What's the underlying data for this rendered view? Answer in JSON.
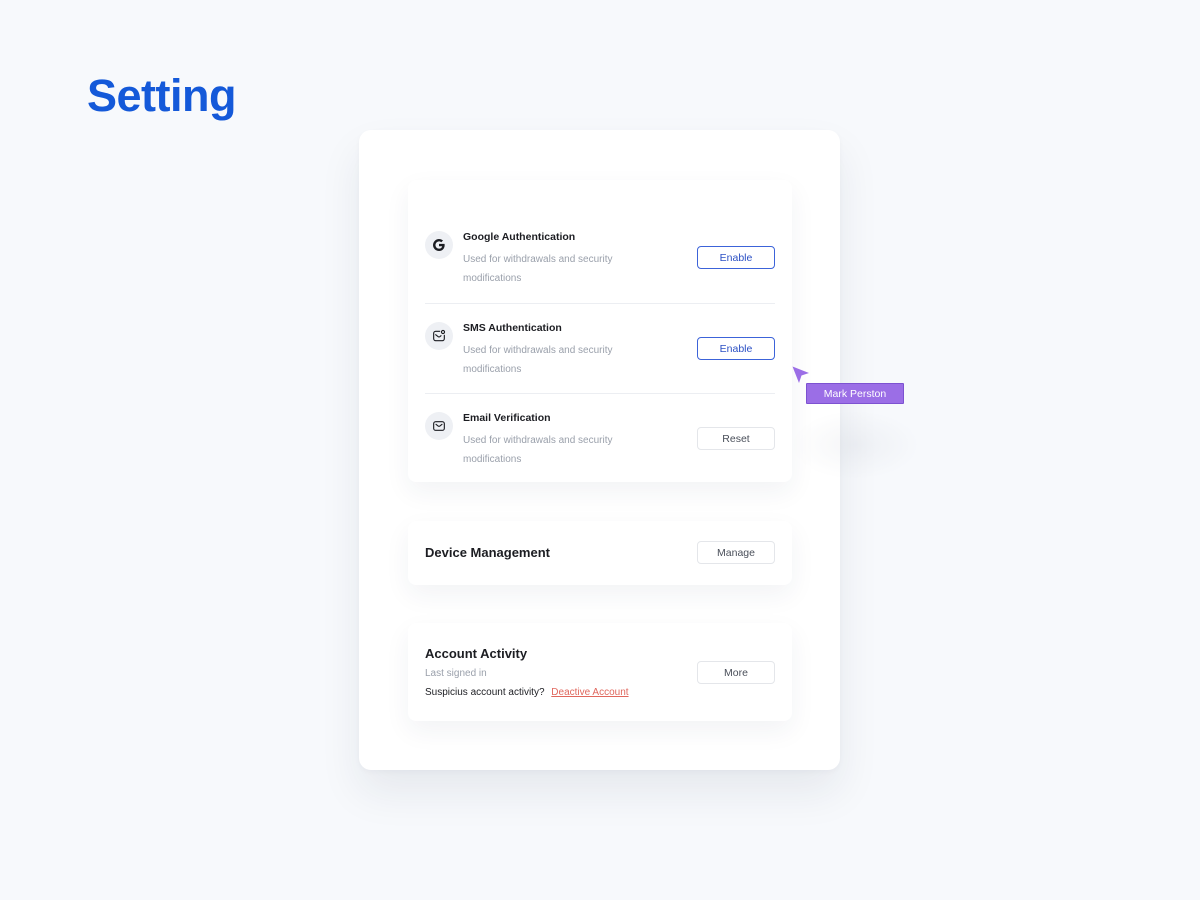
{
  "page": {
    "title": "Setting"
  },
  "auth_section": {
    "items": [
      {
        "title": "Google Authentication",
        "description": "Used for withdrawals and security modifications",
        "button_label": "Enable",
        "icon": "google-icon"
      },
      {
        "title": "SMS Authentication",
        "description": "Used for withdrawals and security modifications",
        "button_label": "Enable",
        "icon": "sms-icon"
      },
      {
        "title": "Email Verification",
        "description": "Used for withdrawals and security modifications",
        "button_label": "Reset",
        "icon": "mail-icon"
      }
    ]
  },
  "device_section": {
    "title": "Device Management",
    "button_label": "Manage"
  },
  "activity_section": {
    "title": "Account Activity",
    "subtitle": "Last signed in",
    "prompt": "Suspicius account activity?",
    "link_label": "Deactive Account",
    "button_label": "More"
  },
  "cursor": {
    "user_name": "Mark Perston",
    "icon": "cursor-arrow-icon"
  },
  "colors": {
    "title_blue": "#1459d9",
    "primary_button": "#3c63d9",
    "link_red": "#e0675d",
    "cursor_purple": "#9b6ee6",
    "background": "#f7f9fc"
  }
}
